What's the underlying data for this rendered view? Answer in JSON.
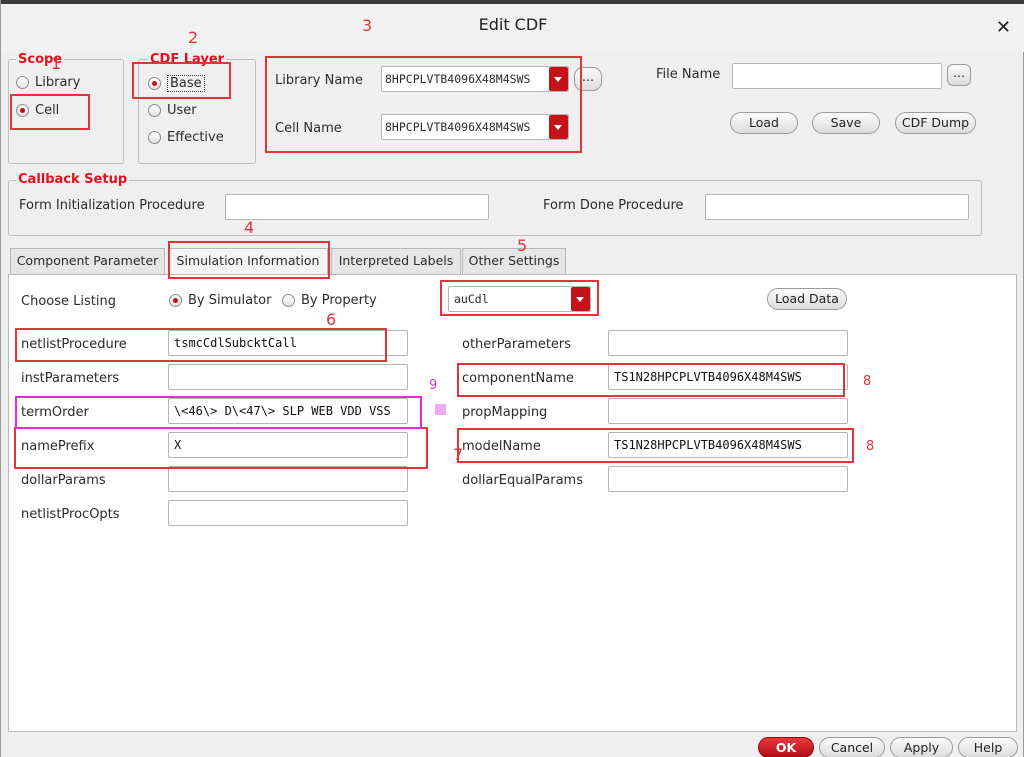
{
  "window": {
    "title": "Edit CDF"
  },
  "scope": {
    "label": "Scope",
    "options": [
      {
        "label": "Library",
        "selected": false
      },
      {
        "label": "Cell",
        "selected": true
      }
    ]
  },
  "cdf_layer": {
    "label": "CDF Layer",
    "options": [
      {
        "label": "Base",
        "selected": true
      },
      {
        "label": "User",
        "selected": false
      },
      {
        "label": "Effective",
        "selected": false
      }
    ]
  },
  "library": {
    "label": "Library Name",
    "value": "8HPCPLVTB4096X48M4SWS"
  },
  "cell": {
    "label": "Cell Name",
    "value": "8HPCPLVTB4096X48M4SWS"
  },
  "browse_label": "...",
  "file": {
    "label": "File Name",
    "value": "",
    "browse_label": "..."
  },
  "file_buttons": {
    "load": "Load",
    "save": "Save",
    "dump": "CDF Dump"
  },
  "callback": {
    "label": "Callback Setup",
    "init_label": "Form Initialization Procedure",
    "init_value": "",
    "done_label": "Form Done Procedure",
    "done_value": ""
  },
  "tabs": [
    {
      "label": "Component Parameter",
      "active": false
    },
    {
      "label": "Simulation Information",
      "active": true
    },
    {
      "label": "Interpreted Labels",
      "active": false
    },
    {
      "label": "Other Settings",
      "active": false
    }
  ],
  "listing": {
    "label": "Choose Listing",
    "by_simulator": "By Simulator",
    "by_property": "By Property",
    "simulator_selected": true,
    "simulator": "auCdl",
    "load_data": "Load Data"
  },
  "left_params": [
    {
      "label": "netlistProcedure",
      "value": "tsmcCdlSubcktCall"
    },
    {
      "label": "instParameters",
      "value": ""
    },
    {
      "label": "termOrder",
      "value": "\\<46\\> D\\<47\\> SLP WEB VDD VSS"
    },
    {
      "label": "namePrefix",
      "value": "X"
    },
    {
      "label": "dollarParams",
      "value": ""
    },
    {
      "label": "netlistProcOpts",
      "value": ""
    }
  ],
  "right_params": [
    {
      "label": "otherParameters",
      "value": ""
    },
    {
      "label": "componentName",
      "value": "TS1N28HPCPLVTB4096X48M4SWS"
    },
    {
      "label": "propMapping",
      "value": ""
    },
    {
      "label": "modelName",
      "value": "TS1N28HPCPLVTB4096X48M4SWS"
    },
    {
      "label": "dollarEqualParams",
      "value": ""
    }
  ],
  "bottom_buttons": {
    "ok": "OK",
    "cancel": "Cancel",
    "apply": "Apply",
    "help": "Help"
  },
  "annotations": {
    "n1": "1",
    "n2": "2",
    "n3": "3",
    "n4": "4",
    "n5": "5",
    "n6": "6",
    "n7": "7",
    "n8a": "8",
    "n8b": "8",
    "n9": "9"
  },
  "colors": {
    "accent": "#c4111a",
    "annotation": "#e4343a",
    "annotation_alt": "#ee22e8"
  }
}
